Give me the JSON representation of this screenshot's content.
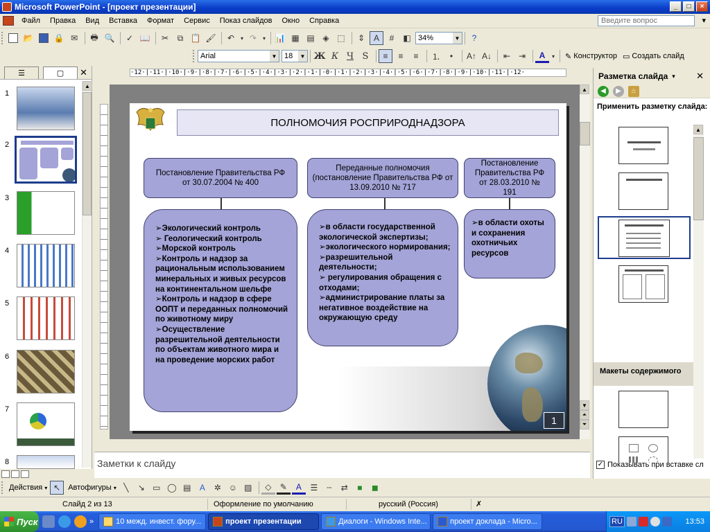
{
  "window": {
    "title": "Microsoft PowerPoint - [проект презентации]"
  },
  "menu": {
    "items": [
      "Файл",
      "Правка",
      "Вид",
      "Вставка",
      "Формат",
      "Сервис",
      "Показ слайдов",
      "Окно",
      "Справка"
    ],
    "ask_placeholder": "Введите вопрос"
  },
  "toolbar": {
    "zoom": "34%",
    "font": "Arial",
    "font_size": "18",
    "designer_label": "Конструктор",
    "new_slide_label": "Создать слайд"
  },
  "slides_pane": {
    "numbers": [
      "1",
      "2",
      "3",
      "4",
      "5",
      "6",
      "7",
      "8"
    ],
    "selected": 2
  },
  "ruler": {
    "h_marks": "·12·|·11·|·10·|·9·|·8·|·7·|·6·|·5·|·4·|·3·|·2·|·1·|·0·|·1·|·2·|·3·|·4·|·5·|·6·|·7·|·8·|·9·|·10·|·11·|·12·"
  },
  "slide": {
    "title": "ПОЛНОМОЧИЯ РОСПРИРОДНАДЗОРА",
    "columns": [
      {
        "header": "Постановление Правительства РФ от 30.07.2004 № 400",
        "items": [
          "➢Экологический контроль",
          "➢ Геологический контроль",
          "➢Морской контроль",
          "➢Контроль и надзор за рациональным использованием минеральных и живых ресурсов на континентальном шельфе",
          "➢Контроль и надзор в сфере ООПТ и переданных полномочий по животному миру",
          "➢Осуществление разрешительной деятельности по объектам животного мира и на проведение морских работ"
        ]
      },
      {
        "header": "Переданные полномочия (постановление Правительства РФ от 13.09.2010 № 717",
        "items": [
          "➢в области государственной экологической экспертизы;",
          "➢экологического нормирования;",
          "➢разрешительной деятельности;",
          "➢ регулирования обращения с отходами;",
          "➢администрирование платы за негативное воздействие на окружающую среду"
        ]
      },
      {
        "header": "Постановление Правительства РФ от 28.03.2010 № 191",
        "items": [
          "➢в области охоты и сохранения охотничьих ресурсов"
        ]
      }
    ],
    "number": "1"
  },
  "notes": {
    "placeholder": "Заметки к слайду"
  },
  "task_pane": {
    "title": "Разметка слайда",
    "apply_label": "Применить разметку слайда:",
    "section_label": "Макеты содержимого",
    "show_on_insert_label": "Показывать при вставке сл"
  },
  "draw_toolbar": {
    "actions_label": "Действия",
    "autoshapes_label": "Автофигуры"
  },
  "status": {
    "slide_counter": "Слайд 2 из 13",
    "design": "Оформление по умолчанию",
    "language": "русский (Россия)"
  },
  "taskbar": {
    "start_label": "Пуск",
    "tasks": [
      "10 межд. инвест. фору...",
      "проект презентации",
      "Диалоги - Windows Inte...",
      "проект доклада - Micro..."
    ],
    "lang": "RU",
    "clock": "13:53"
  },
  "colors": {
    "box_fill": "#a4a4d8",
    "box_border": "#404070",
    "title_fill": "#e6e6f4",
    "xp_blue": "#245edb"
  }
}
